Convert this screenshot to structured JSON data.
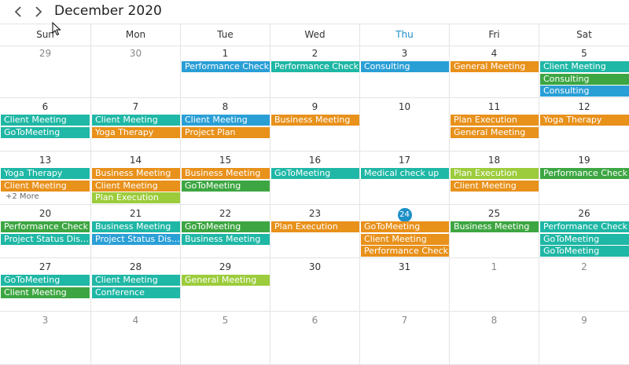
{
  "header": {
    "title": "December 2020",
    "prev_icon": "chevron-left-icon",
    "next_icon": "chevron-right-icon"
  },
  "colors": {
    "teal": "#1fb7a5",
    "orange": "#e8911b",
    "green": "#3da642",
    "blue": "#2a9fd6",
    "lime": "#9ccc3c",
    "today": "#1e90c8"
  },
  "weekdays": [
    "Sun",
    "Mon",
    "Tue",
    "Wed",
    "Thu",
    "Fri",
    "Sat"
  ],
  "today_weekday_index": 4,
  "weeks": [
    [
      {
        "d": "29",
        "muted": true,
        "events": []
      },
      {
        "d": "30",
        "muted": true,
        "events": []
      },
      {
        "d": "1",
        "events": [
          {
            "t": "Performance Check",
            "c": "blue"
          }
        ]
      },
      {
        "d": "2",
        "events": [
          {
            "t": "Performance Check",
            "c": "teal"
          }
        ]
      },
      {
        "d": "3",
        "events": [
          {
            "t": "Consulting",
            "c": "blue"
          }
        ]
      },
      {
        "d": "4",
        "events": [
          {
            "t": "General Meeting",
            "c": "orange"
          }
        ]
      },
      {
        "d": "5",
        "events": [
          {
            "t": "Client Meeting",
            "c": "teal"
          },
          {
            "t": "Consulting",
            "c": "green"
          },
          {
            "t": "Consulting",
            "c": "blue"
          }
        ]
      }
    ],
    [
      {
        "d": "6",
        "events": [
          {
            "t": "Client Meeting",
            "c": "teal"
          },
          {
            "t": "GoToMeeting",
            "c": "teal"
          }
        ]
      },
      {
        "d": "7",
        "events": [
          {
            "t": "Client Meeting",
            "c": "teal"
          },
          {
            "t": "Yoga Therapy",
            "c": "orange"
          }
        ]
      },
      {
        "d": "8",
        "events": [
          {
            "t": "Client Meeting",
            "c": "blue"
          },
          {
            "t": "Project Plan",
            "c": "orange"
          }
        ]
      },
      {
        "d": "9",
        "events": [
          {
            "t": "Business Meeting",
            "c": "orange"
          }
        ]
      },
      {
        "d": "10",
        "events": []
      },
      {
        "d": "11",
        "events": [
          {
            "t": "Plan Execution",
            "c": "orange"
          },
          {
            "t": "General Meeting",
            "c": "orange"
          }
        ]
      },
      {
        "d": "12",
        "events": [
          {
            "t": "Yoga Therapy",
            "c": "orange"
          }
        ]
      }
    ],
    [
      {
        "d": "13",
        "events": [
          {
            "t": "Yoga Therapy",
            "c": "teal"
          },
          {
            "t": "Client Meeting",
            "c": "orange"
          }
        ],
        "more": "+2 More"
      },
      {
        "d": "14",
        "events": [
          {
            "t": "Business Meeting",
            "c": "orange"
          },
          {
            "t": "Client Meeting",
            "c": "orange"
          },
          {
            "t": "Plan Execution",
            "c": "lime"
          }
        ]
      },
      {
        "d": "15",
        "events": [
          {
            "t": "Business Meeting",
            "c": "orange"
          },
          {
            "t": "GoToMeeting",
            "c": "green"
          }
        ]
      },
      {
        "d": "16",
        "events": [
          {
            "t": "GoToMeeting",
            "c": "teal"
          }
        ]
      },
      {
        "d": "17",
        "events": [
          {
            "t": "Medical check up",
            "c": "teal"
          }
        ]
      },
      {
        "d": "18",
        "events": [
          {
            "t": "Plan Execution",
            "c": "lime"
          },
          {
            "t": "Client Meeting",
            "c": "orange"
          }
        ]
      },
      {
        "d": "19",
        "events": [
          {
            "t": "Performance Check",
            "c": "green"
          }
        ]
      }
    ],
    [
      {
        "d": "20",
        "events": [
          {
            "t": "Performance Check",
            "c": "green"
          },
          {
            "t": "Project Status Discussion",
            "c": "teal"
          }
        ]
      },
      {
        "d": "21",
        "events": [
          {
            "t": "Business Meeting",
            "c": "teal"
          },
          {
            "t": "Project Status Discussion",
            "c": "blue"
          }
        ]
      },
      {
        "d": "22",
        "events": [
          {
            "t": "GoToMeeting",
            "c": "green"
          },
          {
            "t": "Business Meeting",
            "c": "teal"
          }
        ]
      },
      {
        "d": "23",
        "events": [
          {
            "t": "Plan Execution",
            "c": "orange"
          }
        ]
      },
      {
        "d": "24",
        "today": true,
        "events": [
          {
            "t": "GoToMeeting",
            "c": "orange"
          },
          {
            "t": "Client Meeting",
            "c": "orange"
          },
          {
            "t": "Performance Check",
            "c": "orange"
          }
        ]
      },
      {
        "d": "25",
        "events": [
          {
            "t": "Business Meeting",
            "c": "green"
          }
        ]
      },
      {
        "d": "26",
        "events": [
          {
            "t": "Performance Check",
            "c": "teal"
          },
          {
            "t": "GoToMeeting",
            "c": "teal"
          },
          {
            "t": "GoToMeeting",
            "c": "teal"
          }
        ]
      }
    ],
    [
      {
        "d": "27",
        "events": [
          {
            "t": "GoToMeeting",
            "c": "teal"
          },
          {
            "t": "Client Meeting",
            "c": "green"
          }
        ]
      },
      {
        "d": "28",
        "events": [
          {
            "t": "Client Meeting",
            "c": "teal"
          },
          {
            "t": "Conference",
            "c": "teal"
          }
        ]
      },
      {
        "d": "29",
        "events": [
          {
            "t": "General Meeting",
            "c": "lime"
          }
        ]
      },
      {
        "d": "30",
        "events": []
      },
      {
        "d": "31",
        "events": []
      },
      {
        "d": "1",
        "muted": true,
        "events": []
      },
      {
        "d": "2",
        "muted": true,
        "events": []
      }
    ],
    [
      {
        "d": "3",
        "muted": true,
        "events": []
      },
      {
        "d": "4",
        "muted": true,
        "events": []
      },
      {
        "d": "5",
        "muted": true,
        "events": []
      },
      {
        "d": "6",
        "muted": true,
        "events": []
      },
      {
        "d": "7",
        "muted": true,
        "events": []
      },
      {
        "d": "8",
        "muted": true,
        "events": []
      },
      {
        "d": "9",
        "muted": true,
        "events": []
      }
    ]
  ]
}
